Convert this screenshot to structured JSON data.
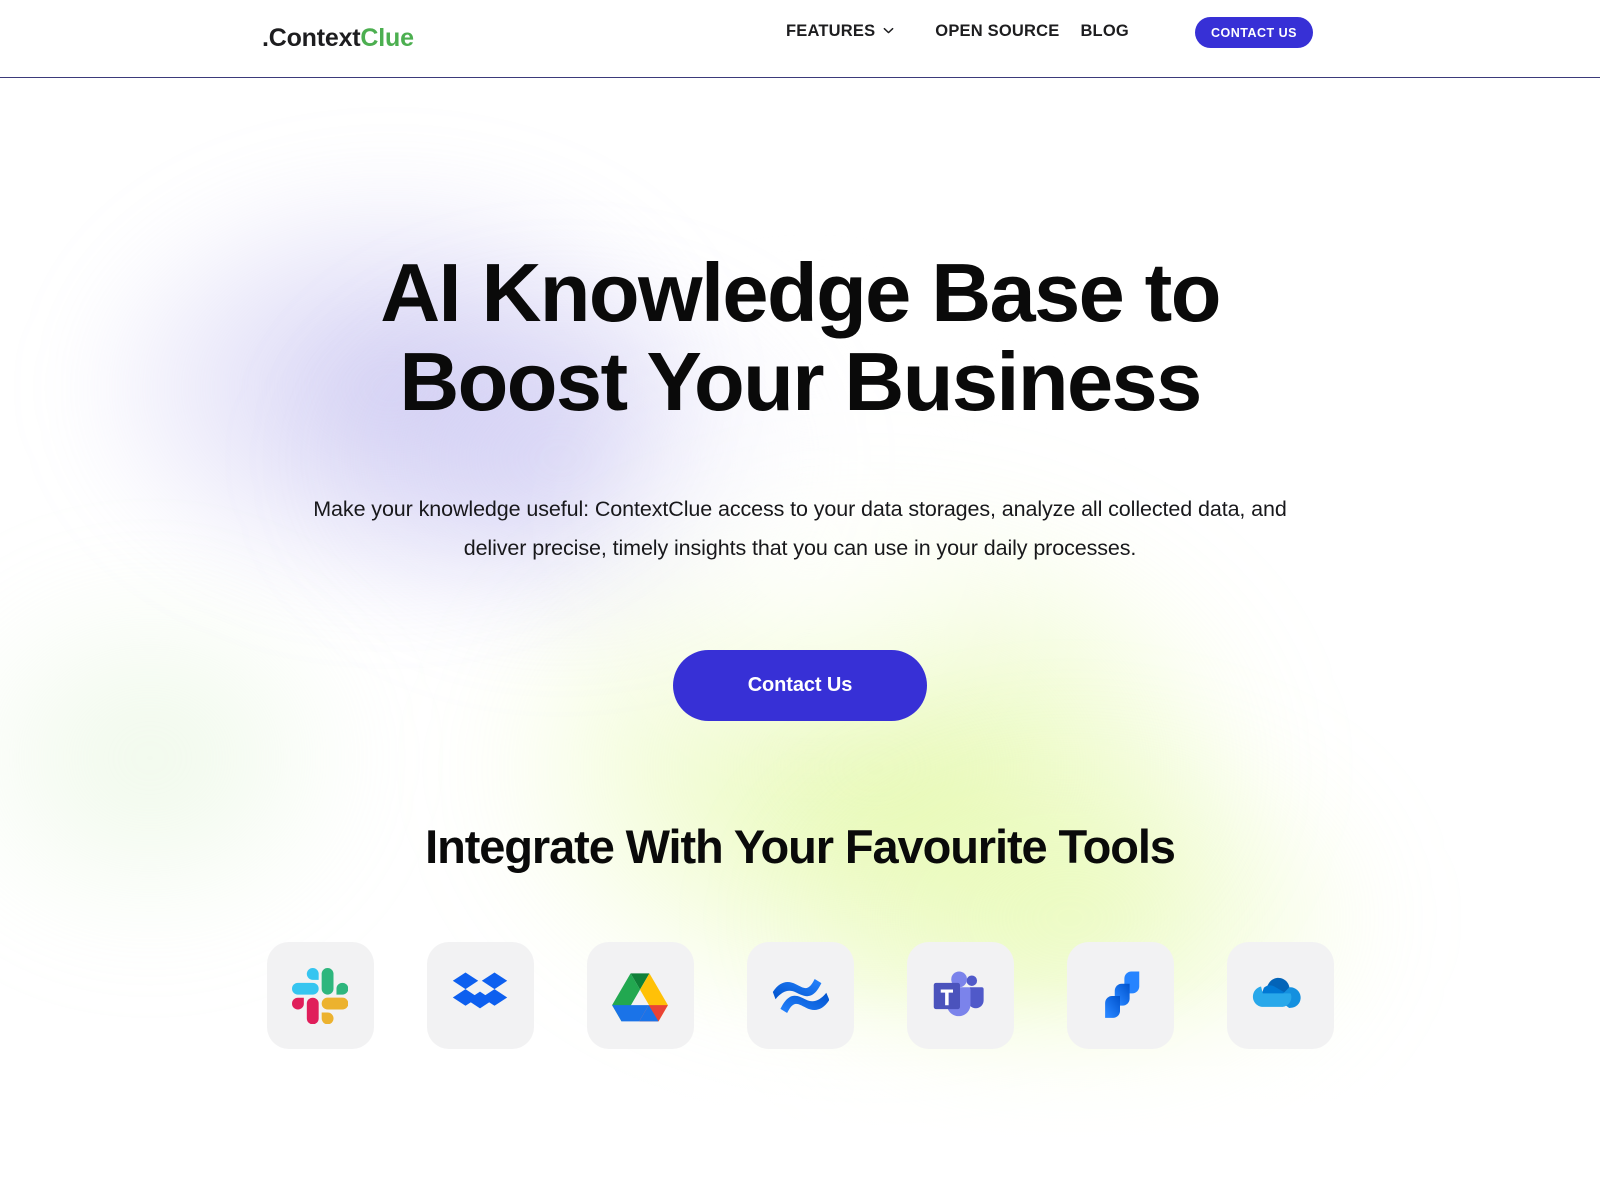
{
  "header": {
    "logo": {
      "prefix": ".",
      "name": "Context",
      "accent": "Clue",
      "accent_color": "#4caf50"
    },
    "nav": [
      {
        "label": "FEATURES",
        "has_dropdown": true,
        "icon": "chevron-down-icon"
      },
      {
        "label": "OPEN SOURCE",
        "has_dropdown": false
      },
      {
        "label": "BLOG",
        "has_dropdown": false
      }
    ],
    "cta_label": "CONTACT US",
    "cta_color": "#3730d6",
    "border_color": "#3b3a7a"
  },
  "hero": {
    "title_line1": "AI Knowledge Base to",
    "title_line2": "Boost Your Business",
    "subtitle": "Make your knowledge useful: ContextClue access to your data storages, analyze all collected data, and deliver precise, timely insights that you can use in your daily processes.",
    "cta_label": "Contact Us",
    "cta_color": "#3730d6"
  },
  "integrations": {
    "title": "Integrate With Your Favourite Tools",
    "tiles": [
      {
        "name": "Slack",
        "icon": "slack-icon"
      },
      {
        "name": "Dropbox",
        "icon": "dropbox-icon"
      },
      {
        "name": "Google Drive",
        "icon": "google-drive-icon"
      },
      {
        "name": "Confluence",
        "icon": "confluence-icon"
      },
      {
        "name": "Microsoft Teams",
        "icon": "microsoft-teams-icon"
      },
      {
        "name": "Jira",
        "icon": "jira-icon"
      },
      {
        "name": "OneDrive",
        "icon": "onedrive-icon"
      }
    ]
  },
  "theme": {
    "background": "#ffffff",
    "glow_purple": "#b0aaeb",
    "glow_lime": "#d6f67c",
    "tile_background": "#f2f2f3",
    "text_primary": "#0a0a0a"
  }
}
